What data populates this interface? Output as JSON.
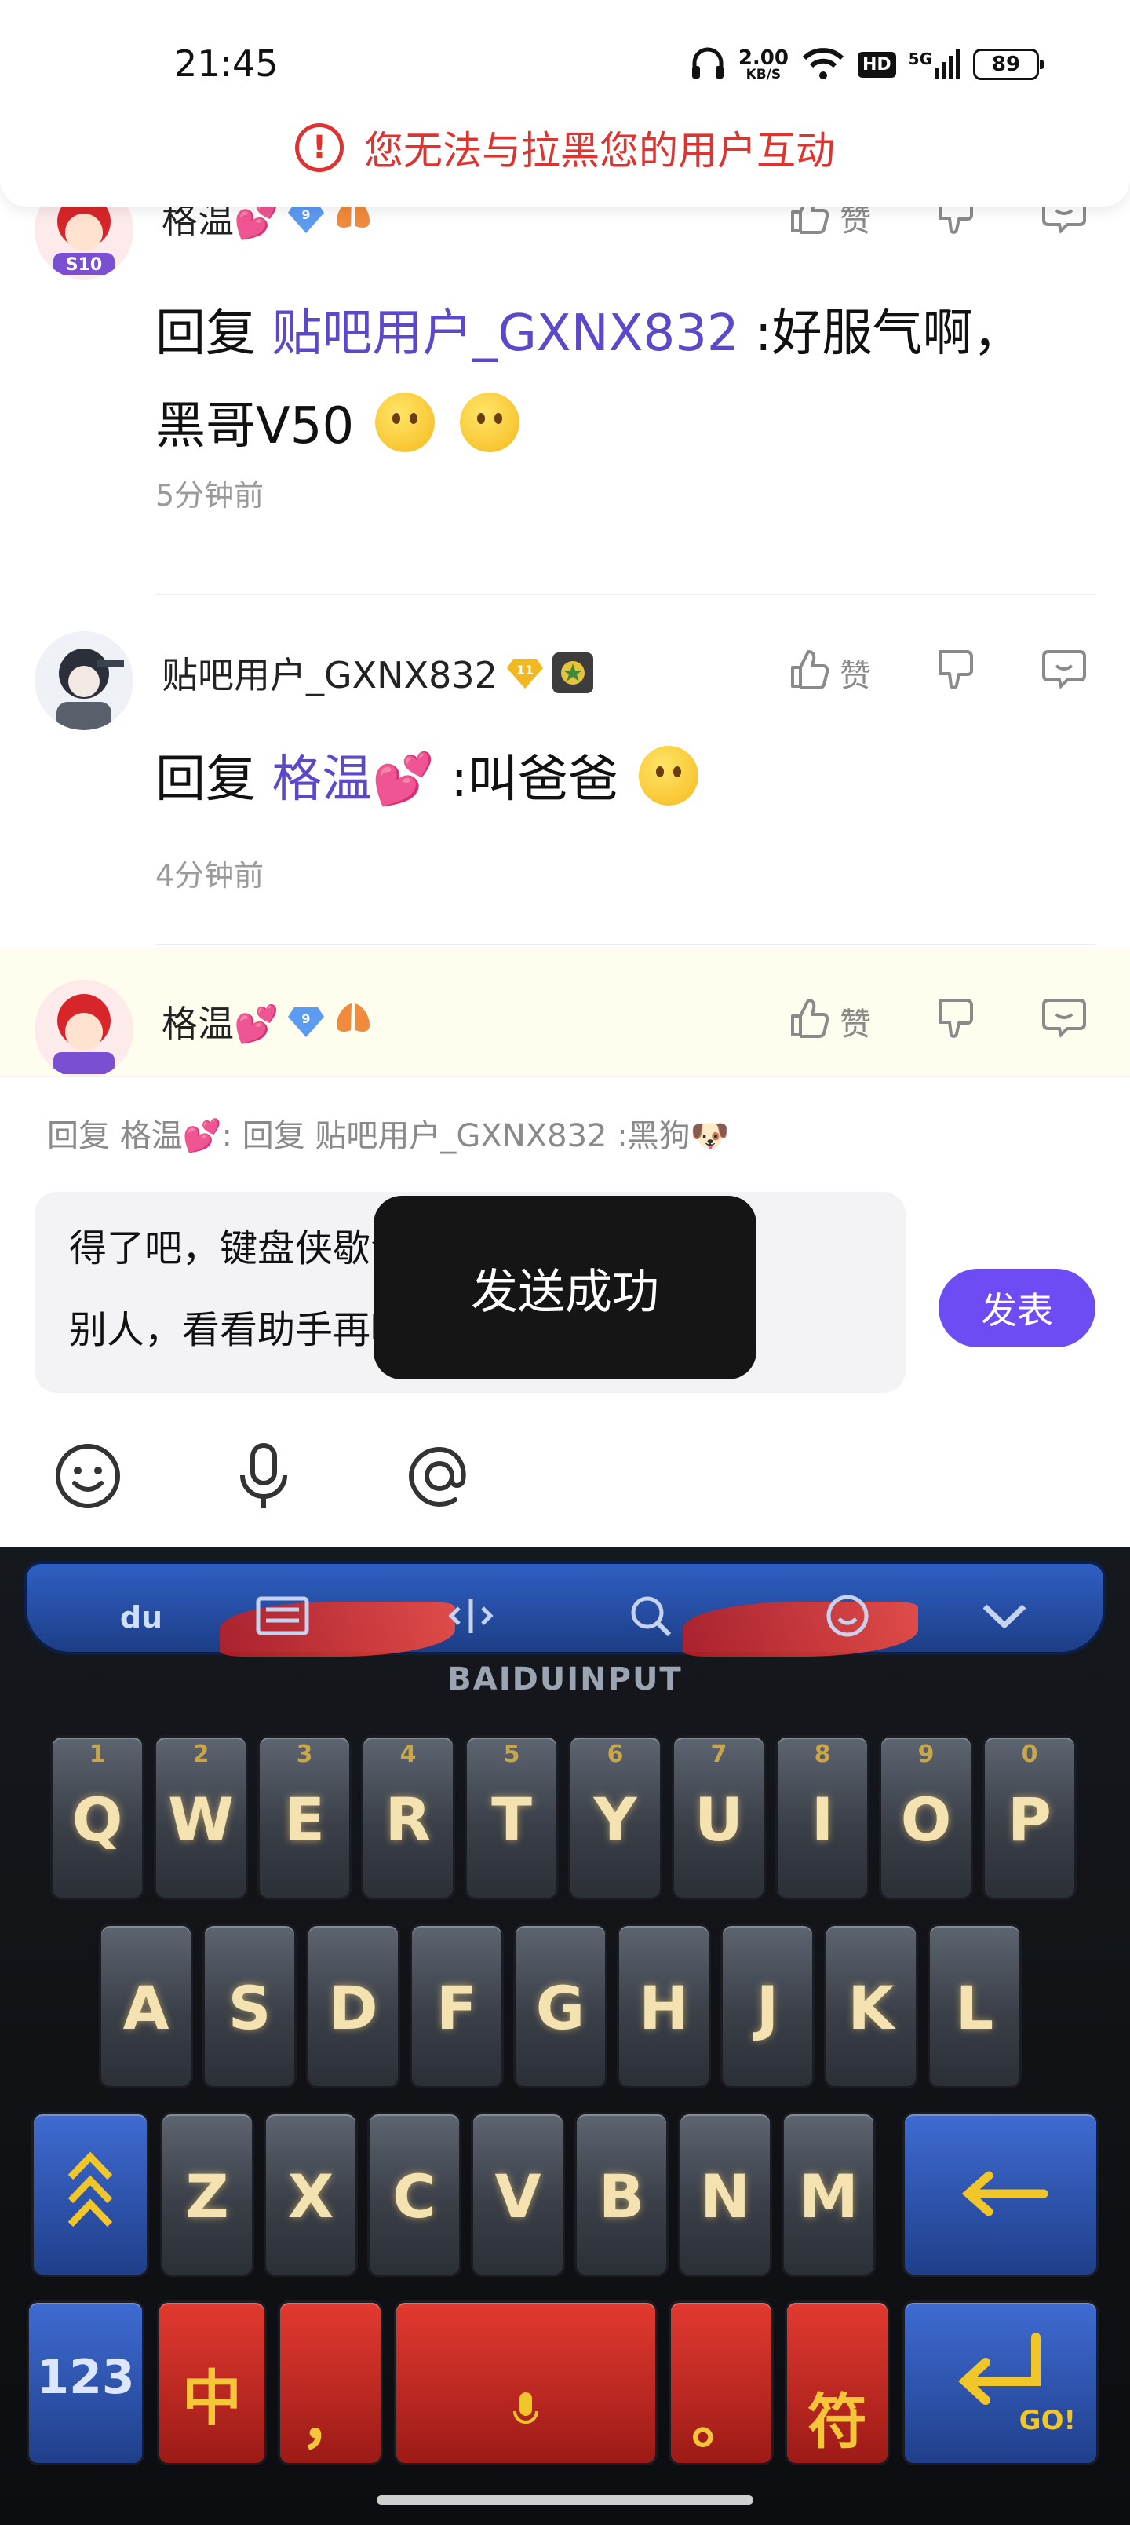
{
  "status_bar": {
    "time": "21:45",
    "net_speed_value": "2.00",
    "net_speed_unit": "KB/S",
    "hd_label": "HD",
    "signal_label": "5G",
    "battery": "89"
  },
  "warning": {
    "text": "您无法与拉黑您的用户互动"
  },
  "comments": [
    {
      "username": "格温💕",
      "level": "9",
      "body_prefix": "回复 ",
      "mention": "贴吧用户_GXNX832",
      "body": " :好服气啊，",
      "body_line2": "黑哥V50",
      "time": "5分钟前",
      "like_label": "赞"
    },
    {
      "username": "贴吧用户_GXNX832",
      "level": "11",
      "body_prefix": "回复 ",
      "mention": "格温💕",
      "body": " :叫爸爸",
      "time": "4分钟前",
      "like_label": "赞"
    },
    {
      "username": "格温💕",
      "level": "9",
      "like_label": "赞"
    }
  ],
  "composer": {
    "reply_hint": "回复 格温💕:  回复 贴吧用户_GXNX832  :黑狗🐶",
    "input_line1": "得了吧，键盘侠歇会吧，别回了🙂以后杠",
    "input_line2": "别人，看看助手再喷🙂",
    "send_label": "发表"
  },
  "toast": {
    "text": "发送成功"
  },
  "keyboard": {
    "brand": "BAIDUINPUT",
    "logo": "du",
    "row1": [
      {
        "num": "1",
        "ch": "Q"
      },
      {
        "num": "2",
        "ch": "W"
      },
      {
        "num": "3",
        "ch": "E"
      },
      {
        "num": "4",
        "ch": "R"
      },
      {
        "num": "5",
        "ch": "T"
      },
      {
        "num": "6",
        "ch": "Y"
      },
      {
        "num": "7",
        "ch": "U"
      },
      {
        "num": "8",
        "ch": "I"
      },
      {
        "num": "9",
        "ch": "O"
      },
      {
        "num": "0",
        "ch": "P"
      }
    ],
    "row2": [
      "A",
      "S",
      "D",
      "F",
      "G",
      "H",
      "J",
      "K",
      "L"
    ],
    "row3": [
      "Z",
      "X",
      "C",
      "V",
      "B",
      "N",
      "M"
    ],
    "num_key": "123",
    "lang_key": "中",
    "comma_key": "，",
    "period_key": "。",
    "symbol_key": "符",
    "go_label": "GO!"
  },
  "colors": {
    "accent": "#6d4cf3",
    "mention": "#5c49c9",
    "warning": "#e0322e"
  }
}
